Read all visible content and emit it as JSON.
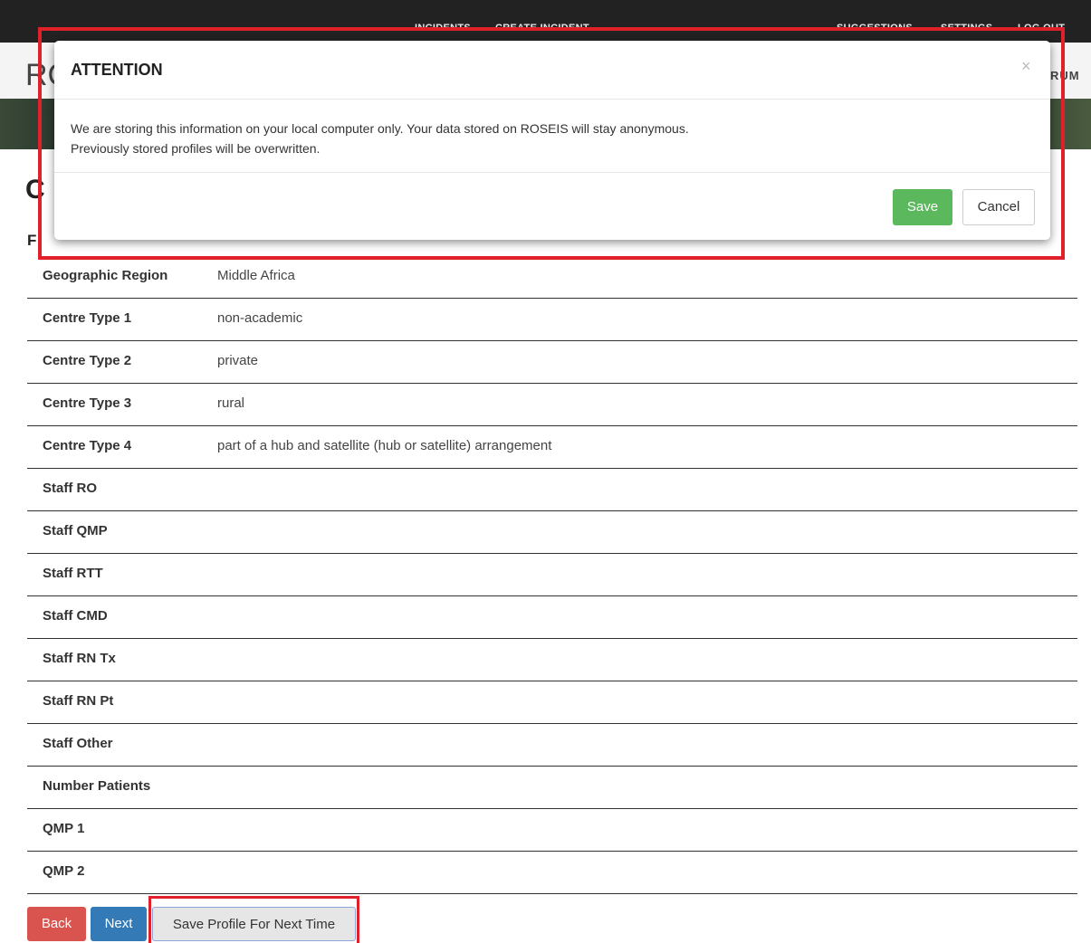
{
  "nav": {
    "items": [
      "INCIDENTS",
      "CREATE INCIDENT",
      "SUGGESTIONS",
      "SETTINGS",
      "LOG OUT"
    ]
  },
  "brand": {
    "left": "RC",
    "right": "RUM"
  },
  "page": {
    "title": "C",
    "section": "F"
  },
  "table": {
    "rows": [
      {
        "label": "Geographic Region",
        "value": "Middle Africa"
      },
      {
        "label": "Centre Type 1",
        "value": "non-academic"
      },
      {
        "label": "Centre Type 2",
        "value": "private"
      },
      {
        "label": "Centre Type 3",
        "value": "rural"
      },
      {
        "label": "Centre Type 4",
        "value": "part of a hub and satellite (hub or satellite) arrangement"
      },
      {
        "label": "Staff RO",
        "value": ""
      },
      {
        "label": "Staff QMP",
        "value": ""
      },
      {
        "label": "Staff RTT",
        "value": ""
      },
      {
        "label": "Staff CMD",
        "value": ""
      },
      {
        "label": "Staff RN Tx",
        "value": ""
      },
      {
        "label": "Staff RN Pt",
        "value": ""
      },
      {
        "label": "Staff Other",
        "value": ""
      },
      {
        "label": "Number Patients",
        "value": ""
      },
      {
        "label": "QMP 1",
        "value": ""
      },
      {
        "label": "QMP 2",
        "value": ""
      }
    ]
  },
  "buttons": {
    "back": "Back",
    "next": "Next",
    "save_profile": "Save Profile For Next Time"
  },
  "modal": {
    "title": "ATTENTION",
    "close": "×",
    "body_line1": "We are storing this information on your local computer only. Your data stored on ROSEIS will stay anonymous.",
    "body_line2": "Previously stored profiles will be overwritten.",
    "save": "Save",
    "cancel": "Cancel"
  },
  "colors": {
    "highlight": "#e0202a",
    "save_green": "#5cb85c",
    "back_red": "#d9534f",
    "next_blue": "#337ab7"
  }
}
